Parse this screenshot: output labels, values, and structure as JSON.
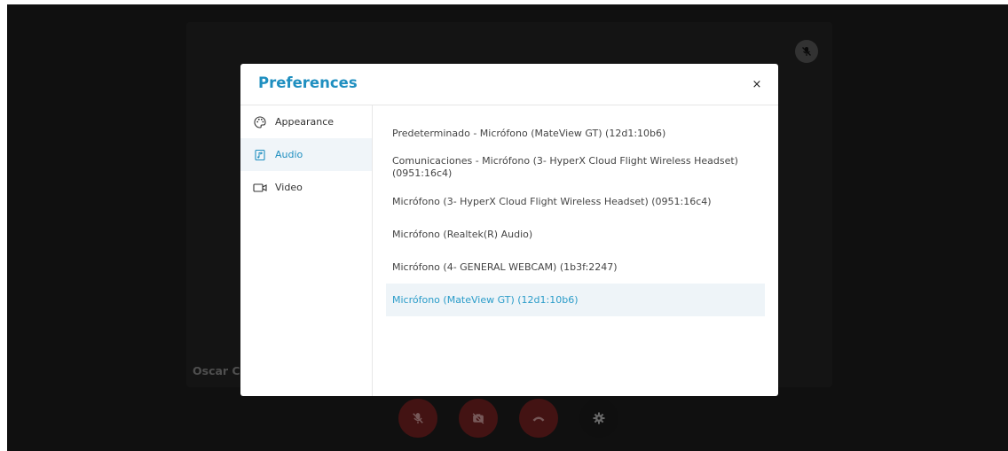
{
  "call": {
    "participant_name": "Oscar C",
    "tile_mute_icon": "mic-off-icon"
  },
  "toolbar": {
    "buttons": [
      {
        "icon": "mic-off-icon",
        "color": "#7a2323"
      },
      {
        "icon": "camera-off-icon",
        "color": "#7a2323"
      },
      {
        "icon": "hang-up-icon",
        "color": "#7a2323"
      },
      {
        "icon": "gear-icon",
        "color": "#1d1d1d"
      }
    ]
  },
  "preferences": {
    "title": "Preferences",
    "close_label": "×",
    "accent_color": "#1f8fc0",
    "sidebar": {
      "items": [
        {
          "label": "Appearance",
          "icon": "palette-icon",
          "active": false
        },
        {
          "label": "Audio",
          "icon": "audio-file-icon",
          "active": true
        },
        {
          "label": "Video",
          "icon": "video-camera-icon",
          "active": false
        }
      ]
    },
    "audio_devices": [
      {
        "label": "Predeterminado - Micrófono (MateView GT) (12d1:10b6)",
        "selected": false
      },
      {
        "label": "Comunicaciones - Micrófono (3- HyperX Cloud Flight Wireless Headset) (0951:16c4)",
        "selected": false
      },
      {
        "label": "Micrófono (3- HyperX Cloud Flight Wireless Headset) (0951:16c4)",
        "selected": false
      },
      {
        "label": "Micrófono (Realtek(R) Audio)",
        "selected": false
      },
      {
        "label": "Micrófono (4- GENERAL WEBCAM) (1b3f:2247)",
        "selected": false
      },
      {
        "label": "Micrófono (MateView GT) (12d1:10b6)",
        "selected": true
      }
    ]
  }
}
